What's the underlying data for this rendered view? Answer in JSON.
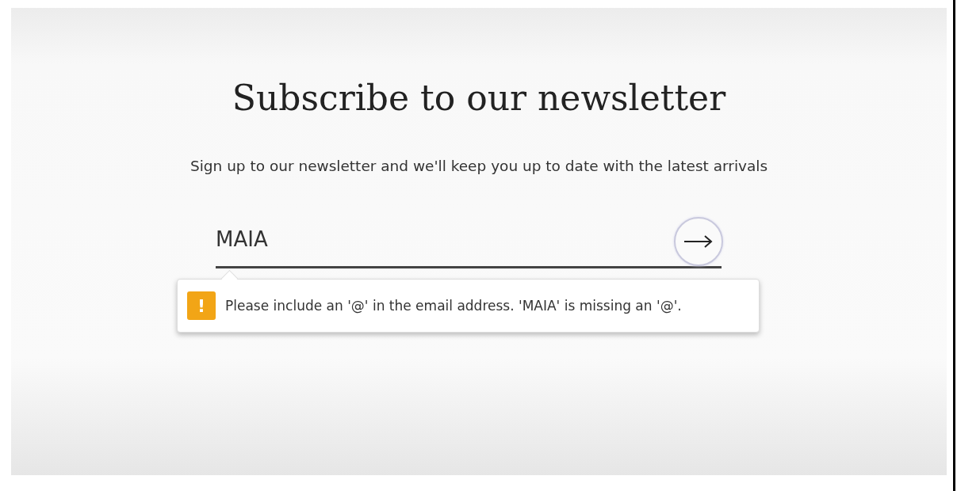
{
  "heading": "Subscribe to our newsletter",
  "subheading": "Sign up to our newsletter and we'll keep you up to date with the latest arrivals",
  "email_field": {
    "value": "MAIA"
  },
  "validation_popup": {
    "symbol": "!",
    "message": "Please include an '@' in the email address. 'MAIA' is missing an '@'."
  }
}
